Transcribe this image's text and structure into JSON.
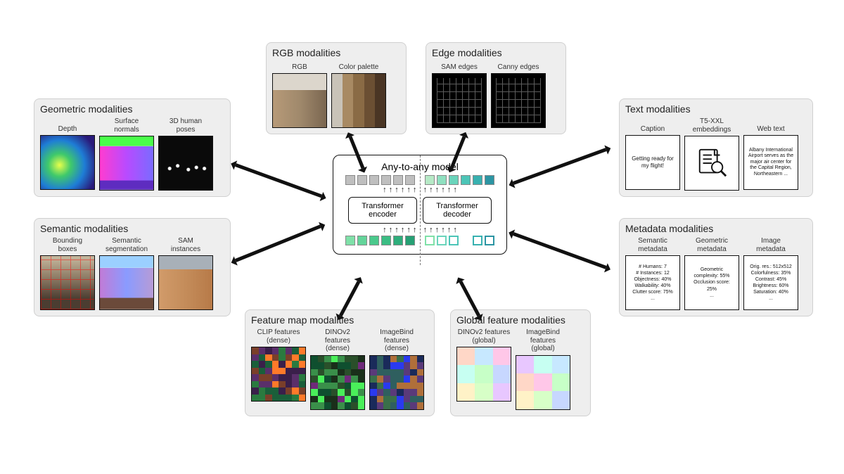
{
  "center": {
    "title": "Any-to-any model",
    "encoder": "Transformer encoder",
    "decoder": "Transformer decoder"
  },
  "panels": {
    "geometric": {
      "title": "Geometric modalities",
      "items": [
        "Depth",
        "Surface\nnormals",
        "3D human\nposes"
      ]
    },
    "semantic": {
      "title": "Semantic modalities",
      "items": [
        "Bounding\nboxes",
        "Semantic\nsegmentation",
        "SAM\ninstances"
      ]
    },
    "rgb": {
      "title": "RGB modalities",
      "items": [
        "RGB",
        "Color palette"
      ]
    },
    "edge": {
      "title": "Edge modalities",
      "items": [
        "SAM edges",
        "Canny edges"
      ]
    },
    "featmap": {
      "title": "Feature map modalities",
      "items": [
        "CLIP features\n(dense)",
        "DINOv2\nfeatures\n(dense)",
        "ImageBind\nfeatures\n(dense)"
      ]
    },
    "globalfeat": {
      "title": "Global feature modalities",
      "items": [
        "DINOv2 features\n(global)",
        "ImageBind\nfeatures\n(global)"
      ]
    },
    "text": {
      "title": "Text modalities",
      "items": [
        "Caption",
        "T5-XXL\nembeddings",
        "Web text"
      ],
      "caption_text": "Getting ready for my flight!",
      "web_text": "Albany International Airport serves as the major air center for the Capital Region, Northeastern ..."
    },
    "metadata": {
      "title": "Metadata modalities",
      "items": [
        "Semantic\nmetadata",
        "Geometric\nmetadata",
        "Image\nmetadata"
      ],
      "semantic_meta": "# Humans: 7\n# Instances: 12\nObjectness: 40%\nWalkability: 40%\nClutter score: 75%\n...",
      "geometric_meta": "Geometric\ncomplexity: 55%\nOcclusion score:\n25%\n...",
      "image_meta": "Orig. res.: 512x512\nColorfulness: 35%\nContrast: 45%\nBrightness: 60%\nSaturation: 40%\n..."
    }
  },
  "palette_colors": [
    "#c9c3b8",
    "#a88a63",
    "#8a6b45",
    "#6b4f33",
    "#4a3524"
  ],
  "token_colors": {
    "gray": "#bfbfbf",
    "enc_in": [
      "#7fe0a8",
      "#64d49a",
      "#4bc98c",
      "#3bbd84",
      "#2fae7c",
      "#26a074"
    ],
    "dec_top": [
      "#b6e9c6",
      "#8fe0c0",
      "#6ad4bb",
      "#4cc5b7",
      "#38b1b0",
      "#2c95a3"
    ],
    "dec_in_border": [
      "#7fe0a8",
      "#6ad4bb",
      "#4cc5b7",
      "#ffffff",
      "#38b1b0",
      "#2c95a3"
    ]
  }
}
